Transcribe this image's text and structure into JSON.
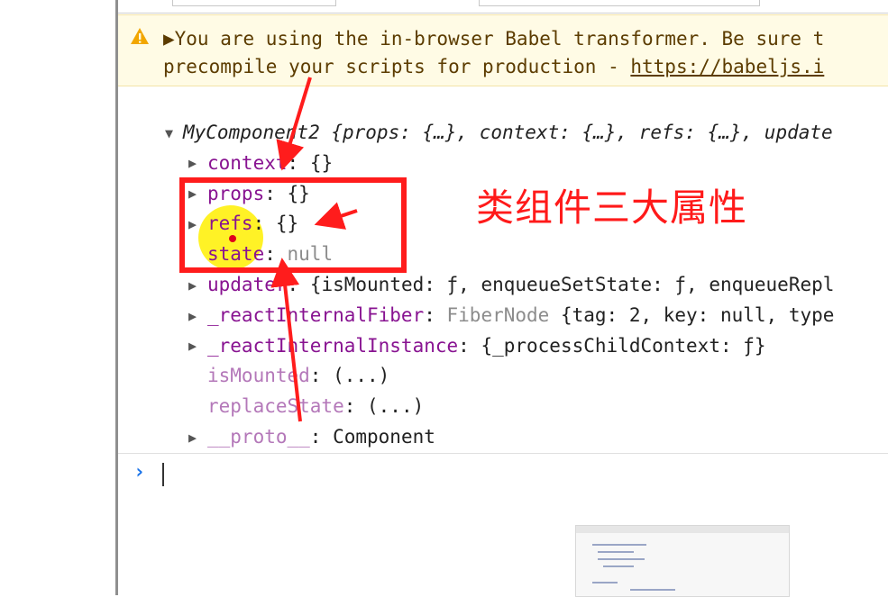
{
  "warning": {
    "icon": "warning-triangle-icon",
    "line1": "▶You are using the in-browser Babel transformer. Be sure t",
    "line2_prefix": "precompile your scripts for production - ",
    "line2_link": "https://babeljs.i"
  },
  "object": {
    "header_name": "MyComponent2",
    "header_rest": " {props: {…}, context: {…}, refs: {…}, update",
    "rows": [
      {
        "key": "context",
        "sep": ": ",
        "value": "{}"
      },
      {
        "key": "props",
        "sep": ": ",
        "value": "{}"
      },
      {
        "key": "refs",
        "sep": ": ",
        "value": "{}"
      },
      {
        "key": "state",
        "sep": ": ",
        "value": "null"
      },
      {
        "key": "updater",
        "sep": ": ",
        "value": "{isMounted: ƒ, enqueueSetState: ƒ, enqueueRepl"
      },
      {
        "key": "_reactInternalFiber",
        "sep": ": ",
        "value_gray": "FiberNode",
        "value": " {tag: 2, key: null, type"
      },
      {
        "key": "_reactInternalInstance",
        "sep": ": ",
        "value": "{_processChildContext: ƒ}"
      },
      {
        "key": "isMounted",
        "sep": ": ",
        "value": "(...)"
      },
      {
        "key": "replaceState",
        "sep": ": ",
        "value": "(...)"
      },
      {
        "key": "__proto__",
        "sep": ": ",
        "value": "Component"
      }
    ]
  },
  "console": {
    "prompt": "›"
  },
  "annotation": {
    "text": "类组件三大属性"
  },
  "colors": {
    "annotation": "#ff1a1a",
    "key_purple": "#881391",
    "warning_bg": "#fffbe5"
  }
}
